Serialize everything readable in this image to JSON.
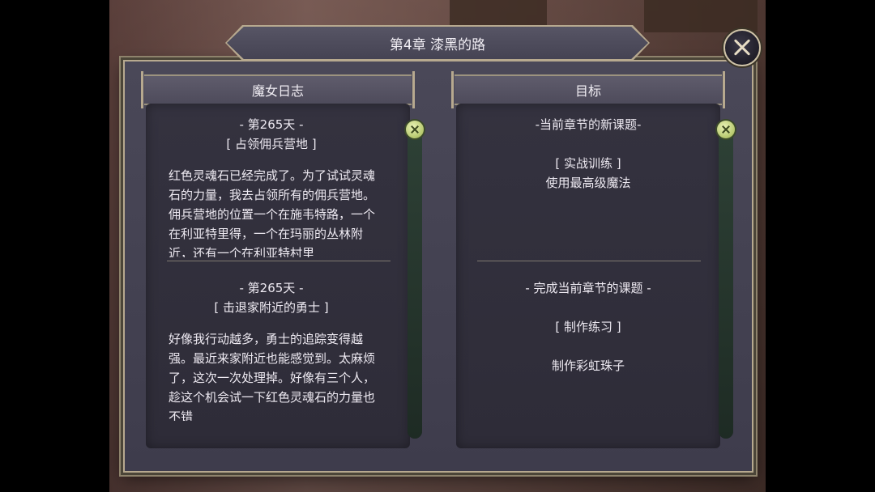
{
  "title": "第4章  漆黑的路",
  "left_panel": {
    "header": "魔女日志",
    "entries": [
      {
        "day": "- 第265天 -",
        "subtitle": "[ 占领佣兵营地 ]",
        "text": "红色灵魂石已经完成了。为了试试灵魂石的力量，我去占领所有的佣兵营地。佣兵营地的位置一个在施韦特路，一个在利亚特里得，一个在玛丽的丛林附近，还有一个在利亚特村里"
      },
      {
        "day": "- 第265天 -",
        "subtitle": "[ 击退家附近的勇士 ]",
        "text": "好像我行动越多，勇士的追踪变得越强。最近来家附近也能感觉到。太麻烦了，这次一次处理掉。好像有三个人，趁这个机会试一下红色灵魂石的力量也不错"
      }
    ]
  },
  "right_panel": {
    "header": "目标",
    "current_title": "-当前章节的新课题-",
    "current_task": "[ 实战训练 ]",
    "current_desc": "使用最高级魔法",
    "completed_title": "- 完成当前章节的课题 -",
    "completed_task": "[ 制作练习 ]",
    "completed_desc": "制作彩虹珠子"
  },
  "icons": {
    "close": "close-icon",
    "scroll_knob": "scroll-knob-icon"
  },
  "colors": {
    "accent_new_goal": "#7ee0d0",
    "frame_border": "#b7a98f",
    "scroll_knob": "#c8d77f"
  }
}
